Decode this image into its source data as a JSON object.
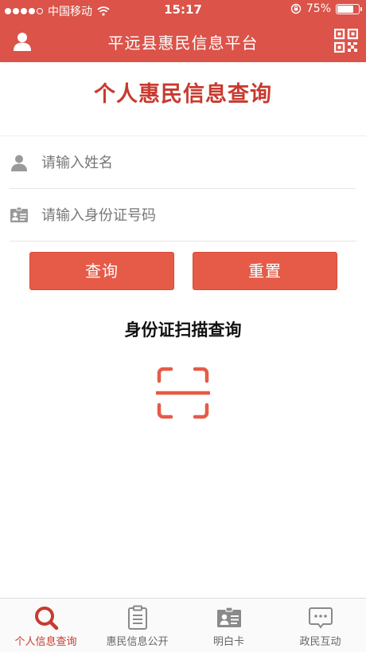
{
  "status_bar": {
    "carrier": "中国移动",
    "time": "15:17",
    "battery_percent": "75%",
    "battery_level": 0.75,
    "signal_bars": 4
  },
  "nav": {
    "title": "平远县惠民信息平台",
    "left_icon": "user-icon",
    "right_icon": "qr-code-icon"
  },
  "page": {
    "title": "个人惠民信息查询"
  },
  "form": {
    "name_placeholder": "请输入姓名",
    "name_value": "",
    "id_placeholder": "请输入身份证号码",
    "id_value": "",
    "query_label": "查询",
    "reset_label": "重置"
  },
  "scan": {
    "title": "身份证扫描查询",
    "icon": "scan-frame-icon"
  },
  "tabs": [
    {
      "label": "个人信息查询",
      "icon": "search-icon",
      "active": true
    },
    {
      "label": "惠民信息公开",
      "icon": "clipboard-icon",
      "active": false
    },
    {
      "label": "明白卡",
      "icon": "id-card-icon",
      "active": false
    },
    {
      "label": "政民互动",
      "icon": "chat-bubble-icon",
      "active": false
    }
  ],
  "colors": {
    "header": "#db5349",
    "accent": "#c83a2f",
    "button": "#e55b47"
  }
}
